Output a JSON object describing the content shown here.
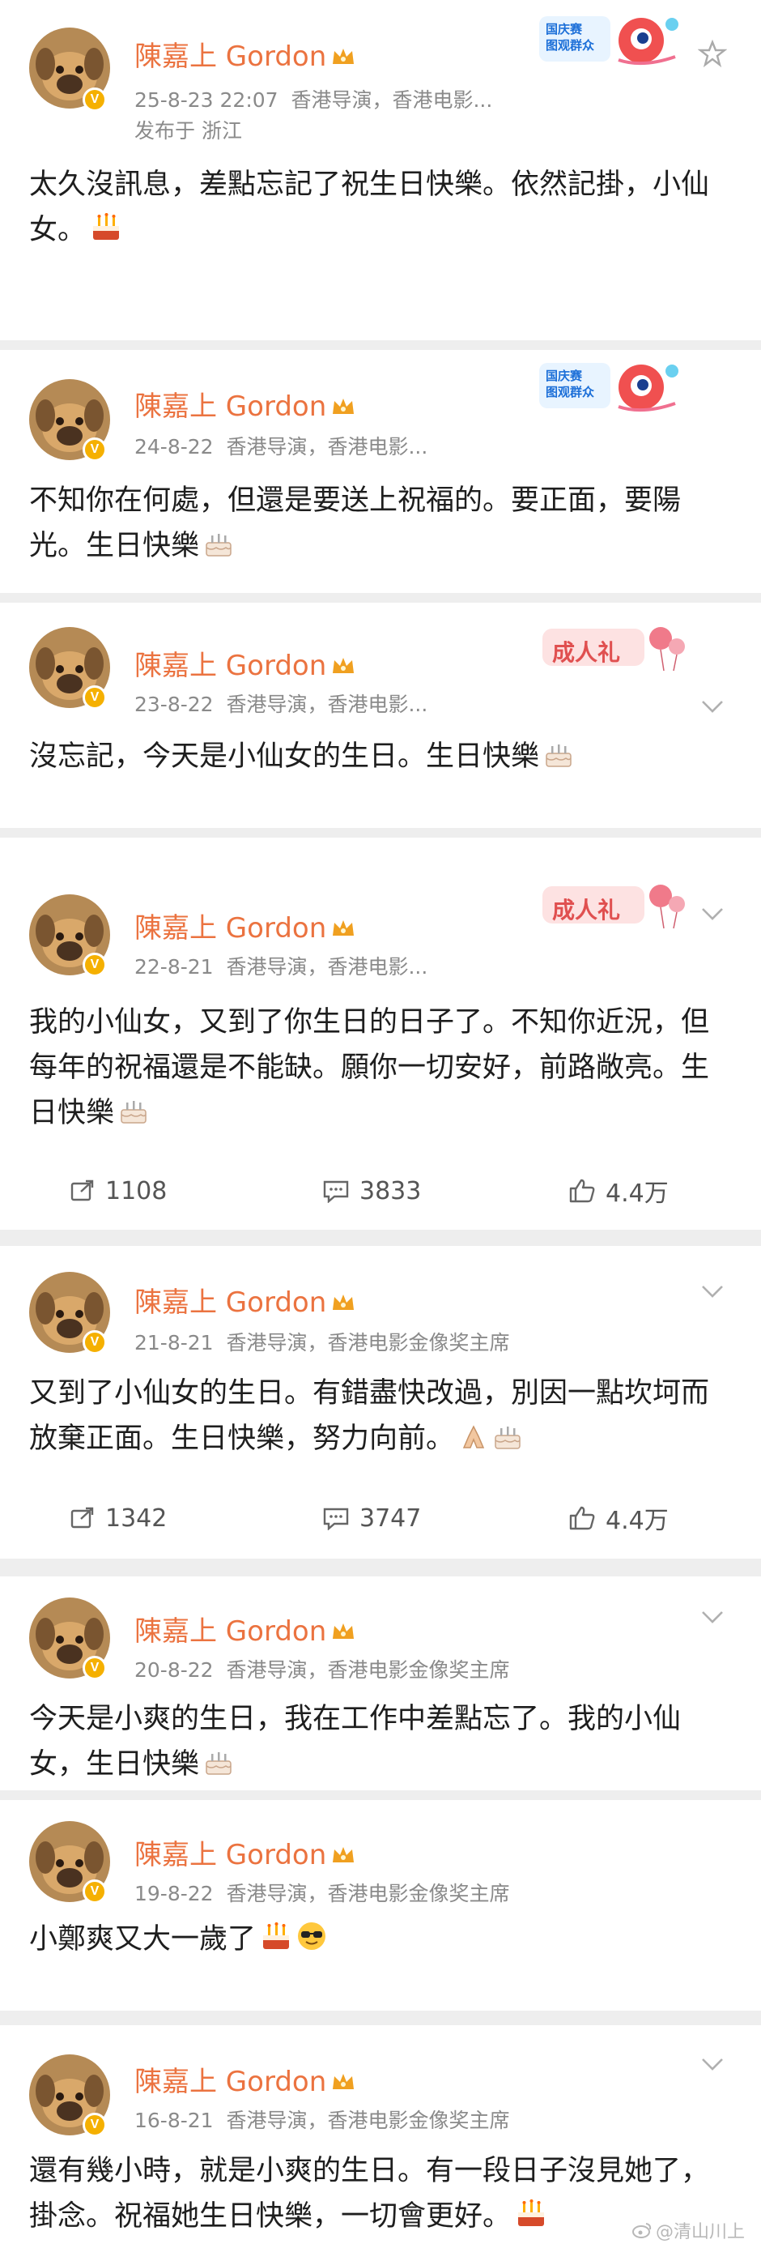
{
  "common": {
    "author": "陳嘉上 Gordon",
    "verified_badge": "V",
    "location": "发布于 浙江"
  },
  "posts": [
    {
      "date": "25-8-23 22:07",
      "source": "香港导演，香港电影...",
      "text": "太久沒訊息，差點忘記了祝生日快樂。依然記掛，小仙女。",
      "emoji": "cake",
      "sticker": "国庆阅兵",
      "sticker_label": "国庆赛\n图观群众"
    },
    {
      "date": "24-8-22",
      "source": "香港导演，香港电影...",
      "text": "不知你在何處，但還是要送上祝福的。要正面，要陽光。生日快樂",
      "emoji": "cake",
      "sticker": "国庆阅兵",
      "sticker_label": "国庆赛\n图观群众"
    },
    {
      "date": "23-8-22",
      "source": "香港导演，香港电影...",
      "text": "沒忘記，今天是小仙女的生日。生日快樂",
      "emoji": "cake",
      "sticker": "成人礼",
      "sticker_label": "成人礼"
    },
    {
      "date": "22-8-21",
      "source": "香港导演，香港电影...",
      "text": "我的小仙女，又到了你生日的日子了。不知你近況，但每年的祝福還是不能缺。願你一切安好，前路敞亮。生日快樂",
      "emoji": "cake",
      "sticker": "成人礼",
      "sticker_label": "成人礼",
      "reposts": "1108",
      "comments": "3833",
      "likes": "4.4万"
    },
    {
      "date": "21-8-21",
      "source": "香港导演，香港电影金像奖主席",
      "text": "又到了小仙女的生日。有錯盡快改過，別因一點坎坷而放棄正面。生日快樂，努力向前。",
      "emoji": "pray+cake",
      "reposts": "1342",
      "comments": "3747",
      "likes": "4.4万"
    },
    {
      "date": "20-8-22",
      "source": "香港导演，香港电影金像奖主席",
      "text": "今天是小爽的生日，我在工作中差點忘了。我的小仙女，生日快樂",
      "emoji": "cake"
    },
    {
      "date": "19-8-22",
      "source": "香港导演，香港电影金像奖主席",
      "text": "小鄭爽又大一歲了",
      "emoji": "cake+sunglasses"
    },
    {
      "date": "16-8-21",
      "source": "香港导演，香港电影金像奖主席",
      "text": "還有幾小時，就是小爽的生日。有一段日子沒見她了，掛念。祝福她生日快樂，一切會更好。",
      "emoji": "cake"
    }
  ],
  "watermark": "@清山川上",
  "colors": {
    "name": "#eb7340",
    "meta": "#8a8a8a",
    "badge": "#f5b000"
  }
}
